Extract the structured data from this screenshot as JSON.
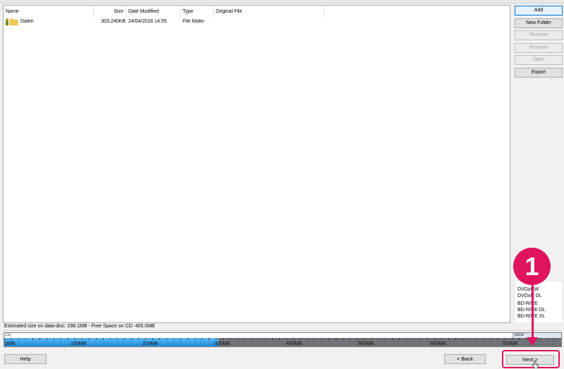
{
  "file_list": {
    "columns": [
      "Name",
      "Size",
      "Date Modified",
      "Type",
      "Original File"
    ],
    "rows": [
      {
        "name": "Daten",
        "size": "303,240KB",
        "date": "24/04/2018 14:55",
        "type": "File folder",
        "original": ""
      }
    ]
  },
  "side_buttons": {
    "add": "Add",
    "new_folder": "New Folder",
    "remove": "Remove",
    "rename": "Rename",
    "open": "Open",
    "export": "Export"
  },
  "disc_types": [
    "DVD±RW",
    "DVD±R DL",
    "BD-R/RE",
    "BD-R/RE DL",
    "BD-R/RE XL"
  ],
  "status_text": "Estimated size on data-disc: 298.1MB - Free Space on CD: 405.0MB",
  "capacity": {
    "cd_label": "CD",
    "dvd_label": "DVD",
    "used_mb": 298.1,
    "max_mb": 780,
    "ticks": [
      "0MB",
      "100MB",
      "200MB",
      "300MB",
      "400MB",
      "500MB",
      "600MB",
      "700MB"
    ],
    "fill_color": "#1e8ad8"
  },
  "bottom_buttons": {
    "help": "Help",
    "back": "< Back",
    "next": "Next >"
  },
  "annotation": {
    "badge_number": "1",
    "color": "#e0135f"
  }
}
